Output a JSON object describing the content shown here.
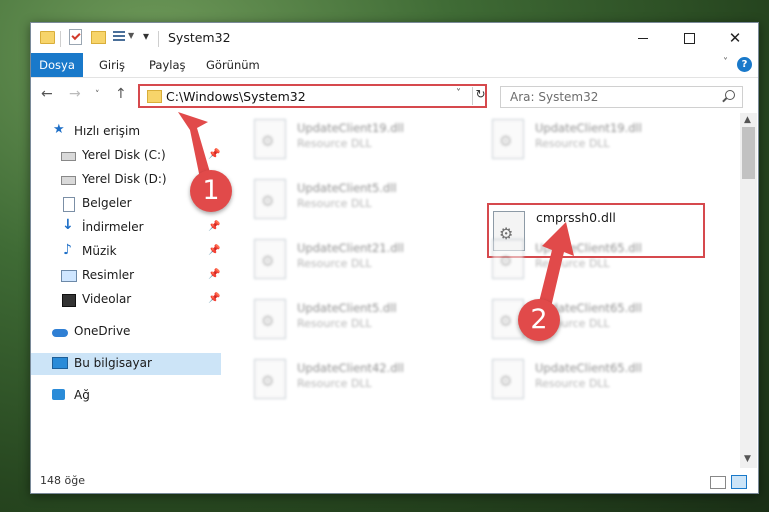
{
  "window": {
    "title": "System32"
  },
  "ribbon": {
    "tabs": [
      "Dosya",
      "Giriş",
      "Paylaş",
      "Görünüm"
    ]
  },
  "address": {
    "path": "C:\\Windows\\System32"
  },
  "search": {
    "placeholder": "Ara: System32"
  },
  "sidebar": {
    "quick_access": "Hızlı erişim",
    "items": [
      {
        "label": "Yerel Disk (C:)",
        "icon": "drive-icon",
        "pinned": true
      },
      {
        "label": "Yerel Disk (D:)",
        "icon": "drive-icon",
        "pinned": false
      },
      {
        "label": "Belgeler",
        "icon": "documents-icon",
        "pinned": true
      },
      {
        "label": "İndirmeler",
        "icon": "downloads-icon",
        "pinned": true
      },
      {
        "label": "Müzik",
        "icon": "music-icon",
        "pinned": true
      },
      {
        "label": "Resimler",
        "icon": "pictures-icon",
        "pinned": true
      },
      {
        "label": "Videolar",
        "icon": "videos-icon",
        "pinned": true
      }
    ],
    "onedrive": "OneDrive",
    "this_pc": "Bu bilgisayar",
    "network": "Ağ"
  },
  "files": [
    {
      "name": "UpdateClient19.dll",
      "desc": "Resource DLL"
    },
    {
      "name": "UpdateClient19.dll",
      "desc": "Resource DLL"
    },
    {
      "name": "UpdateClient5.dll",
      "desc": "Resource DLL"
    },
    {
      "name": "cmprssh0.dll",
      "desc": ""
    },
    {
      "name": "UpdateClient21.dll",
      "desc": "Resource DLL"
    },
    {
      "name": "UpdateClient65.dll",
      "desc": "Resource DLL"
    },
    {
      "name": "UpdateClient5.dll",
      "desc": "Resource DLL"
    },
    {
      "name": "UpdateClient65.dll",
      "desc": "Resource DLL"
    },
    {
      "name": "UpdateClient42.dll",
      "desc": "Resource DLL"
    },
    {
      "name": "UpdateClient65.dll",
      "desc": "Resource DLL"
    }
  ],
  "status": {
    "item_count": "148 öğe"
  },
  "annotations": {
    "badge1": "1",
    "badge2": "2",
    "color": "#e14a4a"
  }
}
